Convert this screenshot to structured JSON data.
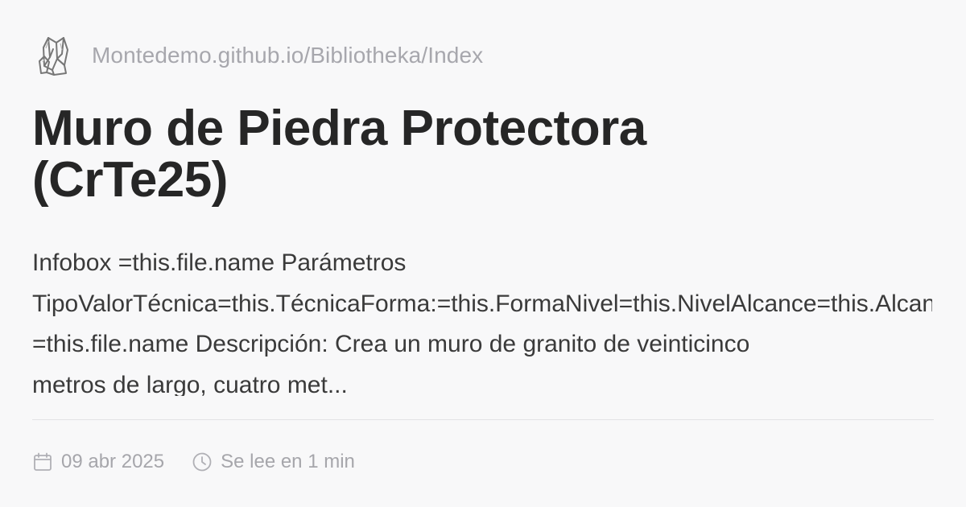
{
  "site": {
    "url": "Montedemo.github.io/Bibliotheka/Index",
    "logo_icon": "crystal-cluster-icon"
  },
  "post": {
    "title_lines": [
      "Muro de Piedra Protectora",
      "(CrTe25)"
    ],
    "excerpt_lines": [
      "Infobox =this.file.name Parámetros",
      "TipoValorTécnica=this.TécnicaForma:=this.FormaNivel=this.NivelAlcance=this.Alcance",
      "=this.file.name Descripción: Crea un muro de granito de veinticinco",
      "metros de largo, cuatro met..."
    ]
  },
  "meta": {
    "date": "09 abr 2025",
    "date_icon": "calendar-icon",
    "reading_time": "Se lee en 1 min",
    "reading_time_icon": "clock-icon"
  },
  "colors": {
    "background": "#f8f8f9",
    "title": "#262626",
    "body": "#3a3a3a",
    "muted": "#a7a7ad",
    "divider": "#e2e2e5"
  }
}
